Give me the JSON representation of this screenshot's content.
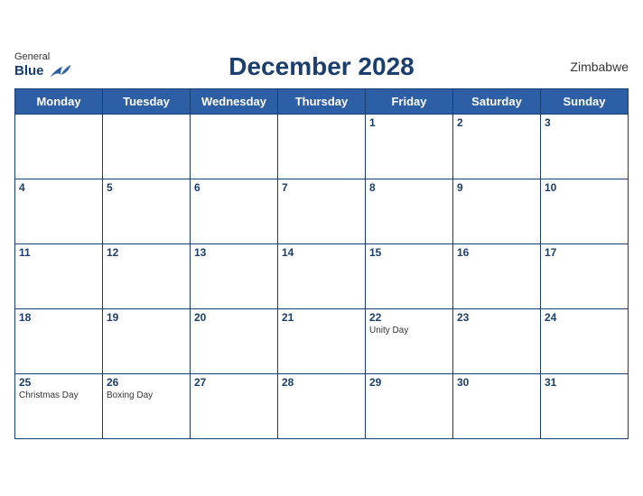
{
  "header": {
    "logo_general": "General",
    "logo_blue": "Blue",
    "title": "December 2028",
    "country": "Zimbabwe"
  },
  "days_of_week": [
    "Monday",
    "Tuesday",
    "Wednesday",
    "Thursday",
    "Friday",
    "Saturday",
    "Sunday"
  ],
  "weeks": [
    [
      {
        "day": "",
        "holiday": ""
      },
      {
        "day": "",
        "holiday": ""
      },
      {
        "day": "",
        "holiday": ""
      },
      {
        "day": "",
        "holiday": ""
      },
      {
        "day": "1",
        "holiday": ""
      },
      {
        "day": "2",
        "holiday": ""
      },
      {
        "day": "3",
        "holiday": ""
      }
    ],
    [
      {
        "day": "4",
        "holiday": ""
      },
      {
        "day": "5",
        "holiday": ""
      },
      {
        "day": "6",
        "holiday": ""
      },
      {
        "day": "7",
        "holiday": ""
      },
      {
        "day": "8",
        "holiday": ""
      },
      {
        "day": "9",
        "holiday": ""
      },
      {
        "day": "10",
        "holiday": ""
      }
    ],
    [
      {
        "day": "11",
        "holiday": ""
      },
      {
        "day": "12",
        "holiday": ""
      },
      {
        "day": "13",
        "holiday": ""
      },
      {
        "day": "14",
        "holiday": ""
      },
      {
        "day": "15",
        "holiday": ""
      },
      {
        "day": "16",
        "holiday": ""
      },
      {
        "day": "17",
        "holiday": ""
      }
    ],
    [
      {
        "day": "18",
        "holiday": ""
      },
      {
        "day": "19",
        "holiday": ""
      },
      {
        "day": "20",
        "holiday": ""
      },
      {
        "day": "21",
        "holiday": ""
      },
      {
        "day": "22",
        "holiday": "Unity Day"
      },
      {
        "day": "23",
        "holiday": ""
      },
      {
        "day": "24",
        "holiday": ""
      }
    ],
    [
      {
        "day": "25",
        "holiday": "Christmas Day"
      },
      {
        "day": "26",
        "holiday": "Boxing Day"
      },
      {
        "day": "27",
        "holiday": ""
      },
      {
        "day": "28",
        "holiday": ""
      },
      {
        "day": "29",
        "holiday": ""
      },
      {
        "day": "30",
        "holiday": ""
      },
      {
        "day": "31",
        "holiday": ""
      }
    ]
  ]
}
